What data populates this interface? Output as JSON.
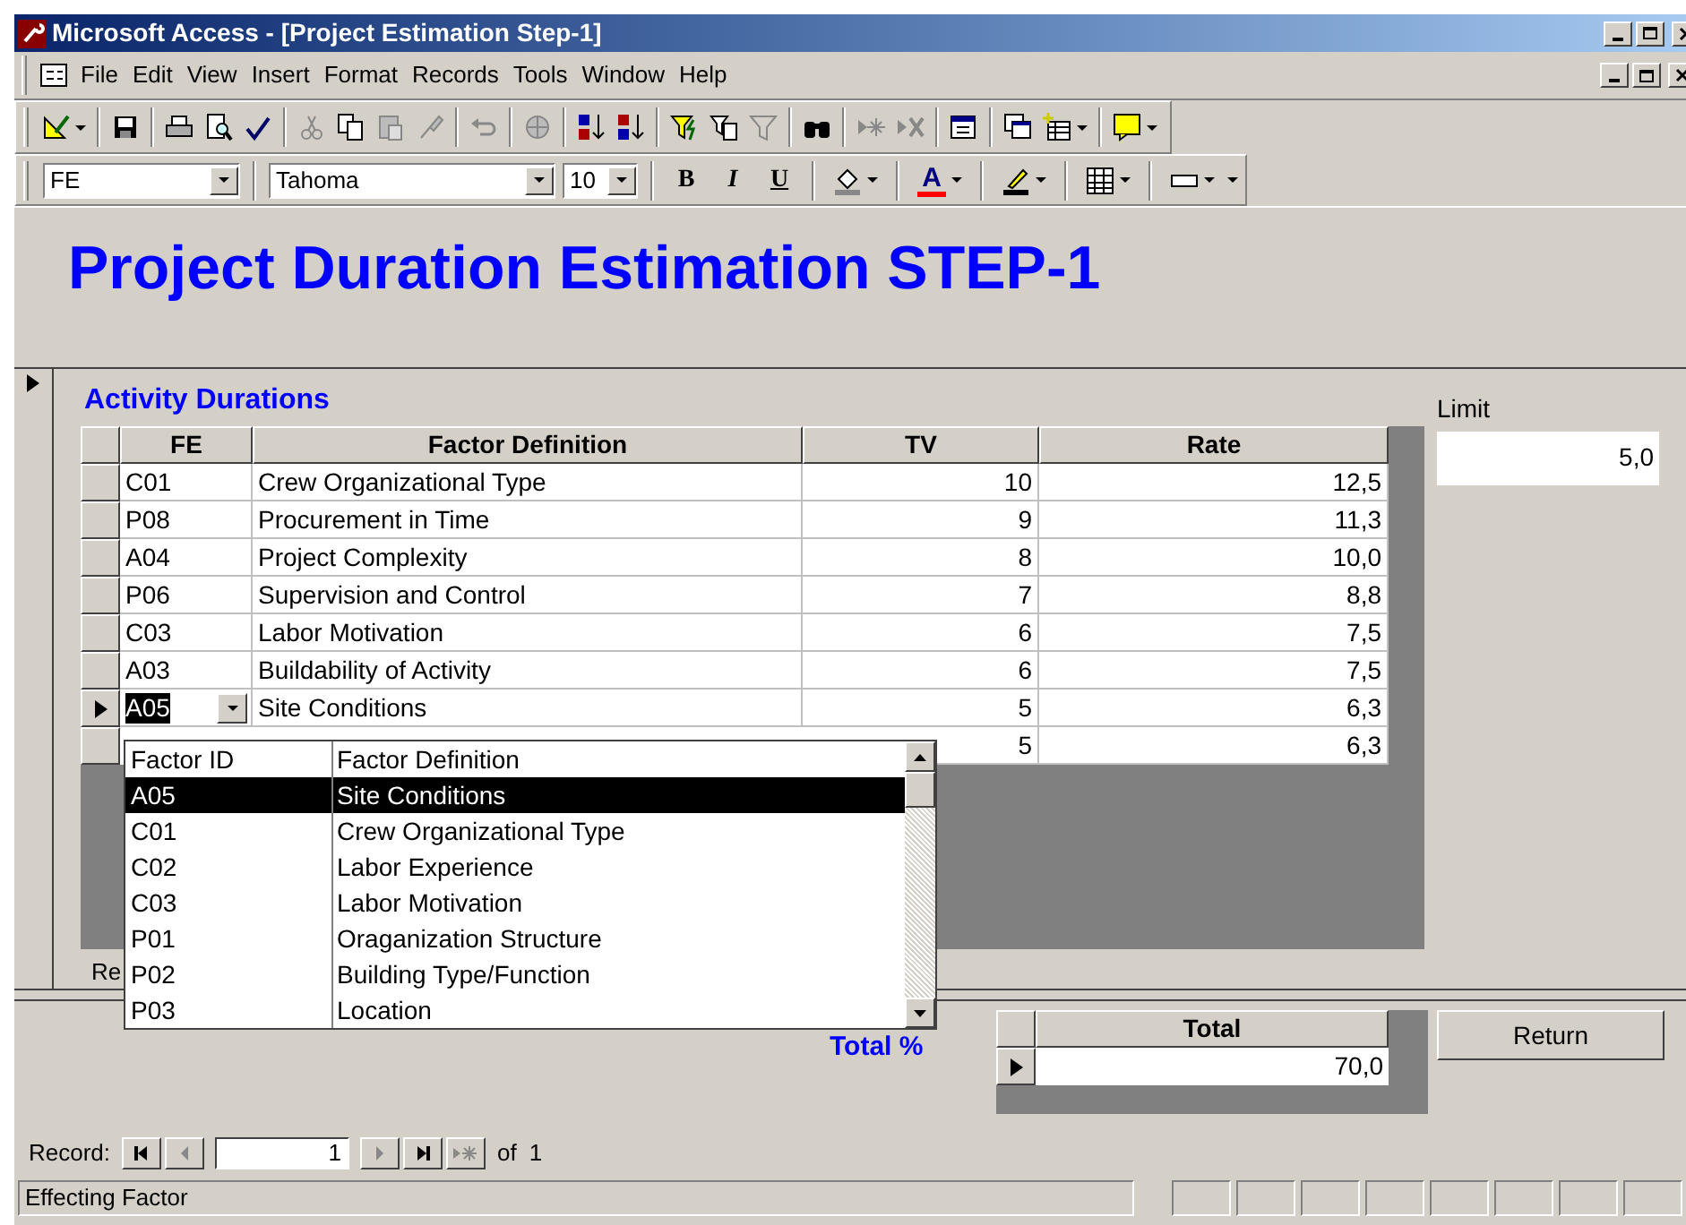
{
  "window": {
    "title": "Microsoft Access - [Project Estimation Step-1]"
  },
  "menu": [
    "File",
    "Edit",
    "View",
    "Insert",
    "Format",
    "Records",
    "Tools",
    "Window",
    "Help"
  ],
  "formatting_toolbar": {
    "object": "FE",
    "font": "Tahoma",
    "size": "10",
    "bold": "B",
    "italic": "I",
    "underline": "U",
    "font_color": "A"
  },
  "form": {
    "title": "Project Duration Estimation STEP-1",
    "subform": {
      "label": "Activity Durations",
      "columns": [
        "FE",
        "Factor Definition",
        "TV",
        "Rate"
      ],
      "rows": [
        {
          "fe": "C01",
          "definition": "Crew Organizational Type",
          "tv": "10",
          "rate": "12,5",
          "selected": false
        },
        {
          "fe": "P08",
          "definition": "Procurement in Time",
          "tv": "9",
          "rate": "11,3",
          "selected": false
        },
        {
          "fe": "A04",
          "definition": "Project Complexity",
          "tv": "8",
          "rate": "10,0",
          "selected": false
        },
        {
          "fe": "P06",
          "definition": "Supervision and Control",
          "tv": "7",
          "rate": "8,8",
          "selected": false
        },
        {
          "fe": "C03",
          "definition": "Labor Motivation",
          "tv": "6",
          "rate": "7,5",
          "selected": false
        },
        {
          "fe": "A03",
          "definition": "Buildability of Activity",
          "tv": "6",
          "rate": "7,5",
          "selected": false
        },
        {
          "fe": "A05",
          "definition": "Site Conditions",
          "tv": "5",
          "rate": "6,3",
          "selected": true
        },
        {
          "tv": "5",
          "rate": "6,3",
          "selected": false
        }
      ],
      "record_label": "Re"
    },
    "limit": {
      "label": "Limit",
      "value": "5,0"
    },
    "dropdown": {
      "columns": [
        "Factor ID",
        "Factor Definition"
      ],
      "items": [
        {
          "id": "A05",
          "definition": "Site Conditions",
          "selected": true
        },
        {
          "id": "C01",
          "definition": "Crew Organizational Type",
          "selected": false
        },
        {
          "id": "C02",
          "definition": "Labor Experience",
          "selected": false
        },
        {
          "id": "C03",
          "definition": "Labor Motivation",
          "selected": false
        },
        {
          "id": "P01",
          "definition": "Oraganization Structure",
          "selected": false
        },
        {
          "id": "P02",
          "definition": "Building Type/Function",
          "selected": false
        },
        {
          "id": "P03",
          "definition": "Location",
          "selected": false
        }
      ]
    },
    "total": {
      "label": "Total %",
      "column": "Total",
      "value": "70,0"
    },
    "return_button": "Return"
  },
  "record_nav": {
    "label": "Record:",
    "current": "1",
    "of": "of",
    "count": "1"
  },
  "status_bar": "Effecting Factor"
}
